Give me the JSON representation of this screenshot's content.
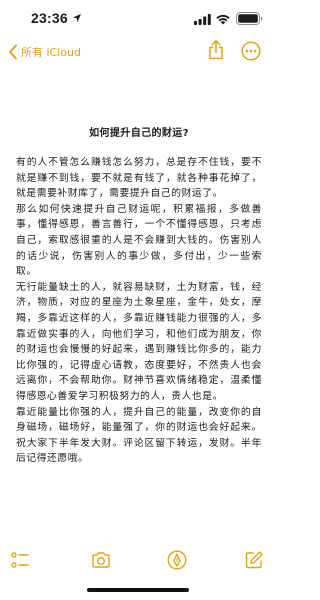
{
  "status": {
    "time": "23:36"
  },
  "nav": {
    "back_label": "所有 iCloud"
  },
  "note": {
    "title": "如何提升自己的财运?",
    "paragraphs": [
      "有的人不管怎么赚钱怎么努力，总是存不住钱，要不就是赚不到钱，要不就是有钱了，就各种事花掉了，就是需要补财库了，需要提升自己的财运了。",
      "那么如何快速提升自己财运呢，积累福报，多做善事，懂得感恩，善言善行，一个不懂得感恩，只考虑自己，索取感很重的人是不会赚到大钱的。伤害别人的话少说，伤害别人的事少做，多付出，少一些索取。",
      "无行能量缺土的人，就容易缺财，土为财富，钱，经济，物质，对应的星座为土象星座，金牛，处女，摩羯，多靠近这样的人，多靠近赚钱能力很强的人，多靠近做实事的人，向他们学习，和他们成为朋友，你的财运也会慢慢的好起来，遇到赚钱比你多的，能力比你强的，记得虚心请教，态度要好，不然贵人也会远离你，不会帮助你。财神节喜欢情绪稳定，温柔懂得感恩心善爱学习积极努力的人，贵人也是。",
      "靠近能量比你强的人，提升自己的能量，改变你的自身磁场，磁场好，能量强了，你的财运也会好起来。祝大家下半年发大财。评论区留下转运，发财。半年后记得还愿哦。"
    ]
  },
  "icons": {
    "location": "location-arrow-icon",
    "signal": "cellular-signal-icon",
    "wifi": "wifi-icon",
    "battery": "battery-icon",
    "back": "chevron-left-icon",
    "share": "share-icon",
    "more": "more-ellipsis-icon",
    "checklist": "checklist-icon",
    "camera": "camera-icon",
    "markup": "markup-pen-icon",
    "compose": "compose-icon"
  },
  "colors": {
    "accent": "#e0a21d",
    "text": "#1c1c1e",
    "background": "#ffffff"
  }
}
